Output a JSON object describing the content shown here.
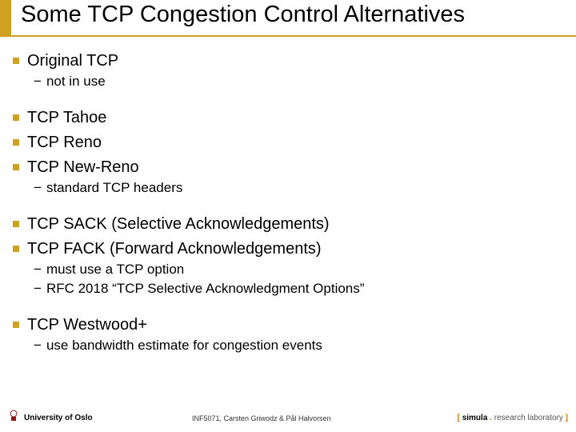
{
  "title": "Some TCP Congestion Control Alternatives",
  "b1": "Original TCP",
  "b1s1": "not in use",
  "b2": "TCP Tahoe",
  "b3": "TCP Reno",
  "b4": "TCP New-Reno",
  "b4s1": "standard TCP headers",
  "b5": "TCP SACK (Selective Acknowledgements)",
  "b6": "TCP FACK (Forward Acknowledgements)",
  "b6s1": "must use a TCP option",
  "b6s2": "RFC 2018 “TCP Selective Acknowledgment Options”",
  "b7": "TCP Westwood+",
  "b7s1": "use bandwidth estimate for congestion events",
  "footer": {
    "university": "University of Oslo",
    "course": "INF5071, Carsten Griwodz & Pål Halvorsen",
    "simula_open": "[ ",
    "simula_name": "simula",
    "simula_dot": " . ",
    "simula_rest": "research laboratory",
    "simula_close": " ]"
  }
}
